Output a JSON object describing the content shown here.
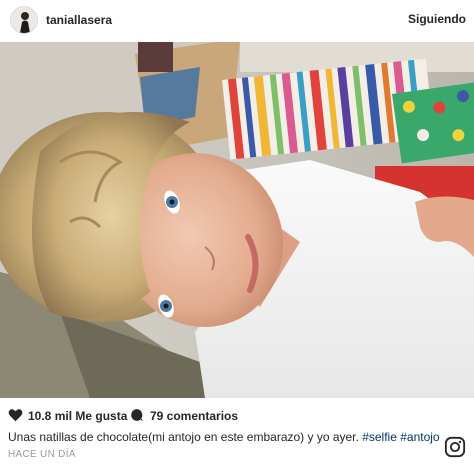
{
  "post": {
    "username": "taniallasera",
    "follow_label": "Siguiendo",
    "likes": "10.8 mil Me gusta",
    "comments": "79 comentarios",
    "caption_text": "Unas natillas de chocolate(mi antojo en este embarazo) y yo ayer.",
    "hashtags": [
      "#selfie",
      "#antojo"
    ],
    "timestamp": "HACE UN DÍA"
  },
  "colors": {
    "text": "#262626",
    "hashtag": "#003569",
    "muted": "#999999"
  },
  "icons": [
    "heart-icon",
    "comment-icon",
    "instagram-logo-icon"
  ]
}
